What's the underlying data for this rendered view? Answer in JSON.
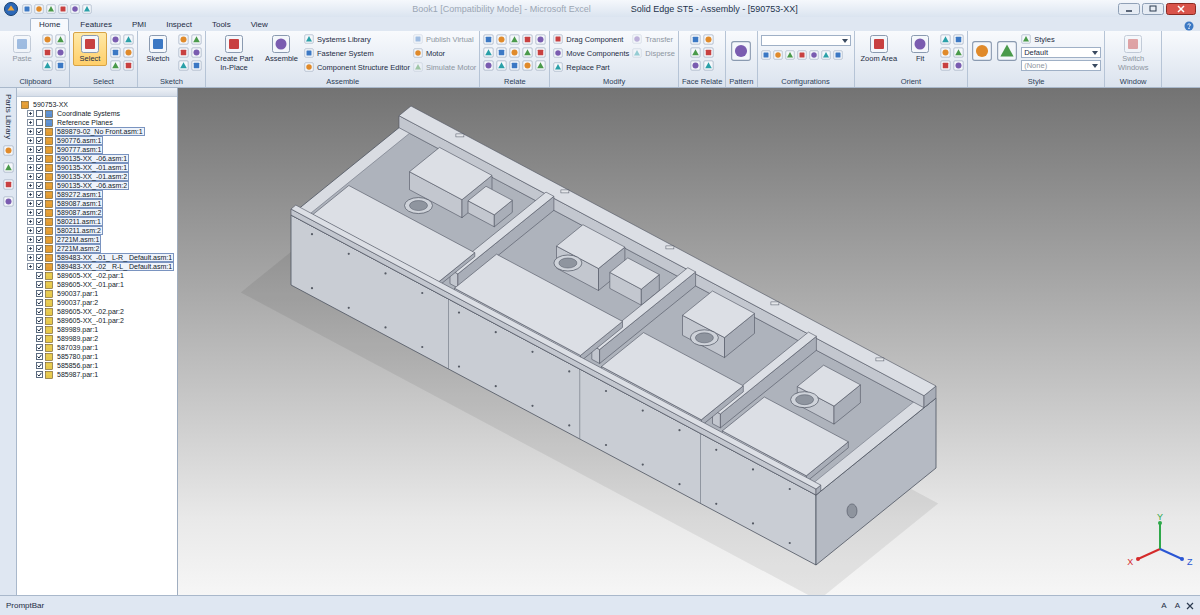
{
  "window": {
    "title": "Solid Edge ST5 - Assembly - [590753-XX]",
    "background_title": "Book1 [Compatibility Mode] - Microsoft Excel"
  },
  "tabs": [
    {
      "label": "Home",
      "selected": true
    },
    {
      "label": "Features",
      "selected": false
    },
    {
      "label": "PMI",
      "selected": false
    },
    {
      "label": "Inspect",
      "selected": false
    },
    {
      "label": "Tools",
      "selected": false
    },
    {
      "label": "View",
      "selected": false
    }
  ],
  "ribbon": [
    {
      "label": "Clipboard",
      "items": [
        {
          "kind": "large",
          "label": "Paste",
          "disabled": true,
          "selected": false
        },
        {
          "kind": "icons",
          "disabled": false
        }
      ]
    },
    {
      "label": "Select",
      "items": [
        {
          "kind": "large",
          "label": "Select",
          "disabled": false,
          "selected": true
        },
        {
          "kind": "icons",
          "disabled": false
        }
      ]
    },
    {
      "label": "Sketch",
      "items": [
        {
          "kind": "large",
          "label": "Sketch",
          "disabled": false,
          "selected": false
        },
        {
          "kind": "icons",
          "disabled": false
        }
      ]
    },
    {
      "label": "Assemble",
      "items": [
        {
          "kind": "large",
          "label": "Create Part In-Place",
          "disabled": false,
          "selected": false
        },
        {
          "kind": "large",
          "label": "Assemble",
          "disabled": false,
          "selected": false
        },
        {
          "kind": "stack",
          "entries": [
            {
              "kind": "item",
              "label": "Systems Library",
              "disabled": false
            },
            {
              "kind": "item",
              "label": "Fastener System",
              "disabled": false
            },
            {
              "kind": "item",
              "label": "Component Structure Editor",
              "disabled": false
            }
          ]
        },
        {
          "kind": "stack",
          "entries": [
            {
              "kind": "item",
              "label": "Publish Virtual",
              "disabled": true
            },
            {
              "kind": "item",
              "label": "Motor",
              "disabled": false
            },
            {
              "kind": "item",
              "label": "Simulate Motor",
              "disabled": true
            }
          ]
        }
      ]
    },
    {
      "label": "Relate",
      "items": [
        {
          "kind": "icon-bank",
          "disabled": false
        }
      ]
    },
    {
      "label": "Modify",
      "items": [
        {
          "kind": "stack",
          "entries": [
            {
              "kind": "item",
              "label": "Drag Component",
              "disabled": false
            },
            {
              "kind": "item",
              "label": "Move Components",
              "disabled": false
            },
            {
              "kind": "item",
              "label": "Replace Part",
              "disabled": false
            }
          ]
        },
        {
          "kind": "stack",
          "entries": [
            {
              "kind": "item",
              "label": "Transfer",
              "disabled": true
            },
            {
              "kind": "item",
              "label": "Disperse",
              "disabled": true
            }
          ]
        }
      ]
    },
    {
      "label": "Face Relate",
      "items": [
        {
          "kind": "icons",
          "disabled": false
        }
      ]
    },
    {
      "label": "Pattern",
      "items": [
        {
          "kind": "big-icon",
          "disabled": false
        }
      ]
    },
    {
      "label": "Configurations",
      "items": [
        {
          "kind": "combo-bar",
          "disabled": false
        }
      ]
    },
    {
      "label": "Orient",
      "items": [
        {
          "kind": "large",
          "label": "Zoom Area",
          "disabled": false,
          "selected": false
        },
        {
          "kind": "large",
          "label": "Fit",
          "disabled": false,
          "selected": false
        },
        {
          "kind": "icons",
          "disabled": false
        }
      ]
    },
    {
      "label": "Style",
      "items": [
        {
          "kind": "big-icon",
          "disabled": false
        },
        {
          "kind": "big-icon",
          "disabled": false
        },
        {
          "kind": "stack",
          "entries": [
            {
              "kind": "item",
              "label": "Styles",
              "disabled": false
            },
            {
              "kind": "dropdown",
              "label": "Default",
              "disabled": false
            },
            {
              "kind": "dropdown",
              "label": "(None)",
              "disabled": true
            }
          ]
        }
      ]
    },
    {
      "label": "Window",
      "items": [
        {
          "kind": "large",
          "label": "Switch Windows",
          "disabled": true,
          "selected": false
        }
      ]
    }
  ],
  "side_strip": {
    "label": "Parts Library"
  },
  "tree": {
    "root": "590753-XX",
    "items": [
      {
        "label": "Coordinate Systems",
        "kind": "folder",
        "checked": false,
        "selected": false,
        "expanded": false
      },
      {
        "label": "Reference Planes",
        "kind": "folder",
        "checked": false,
        "selected": false,
        "expanded": false
      },
      {
        "label": "589879-02_No Front.asm:1",
        "kind": "asm",
        "checked": true,
        "selected": true,
        "expanded": false
      },
      {
        "label": "590776.asm:1",
        "kind": "asm",
        "checked": true,
        "selected": true,
        "expanded": false
      },
      {
        "label": "590777.asm:1",
        "kind": "asm",
        "checked": true,
        "selected": true,
        "expanded": false
      },
      {
        "label": "590135-XX_-06.asm:1",
        "kind": "asm",
        "checked": true,
        "selected": true,
        "expanded": false
      },
      {
        "label": "590135-XX_-01.asm:1",
        "kind": "asm",
        "checked": true,
        "selected": true,
        "expanded": false
      },
      {
        "label": "590135-XX_-01.asm:2",
        "kind": "asm",
        "checked": true,
        "selected": true,
        "expanded": false
      },
      {
        "label": "590135-XX_-06.asm:2",
        "kind": "asm",
        "checked": true,
        "selected": true,
        "expanded": false
      },
      {
        "label": "589272.asm:1",
        "kind": "asm",
        "checked": true,
        "selected": true,
        "expanded": false
      },
      {
        "label": "589087.asm:1",
        "kind": "asm",
        "checked": true,
        "selected": true,
        "expanded": false
      },
      {
        "label": "589087.asm:2",
        "kind": "asm",
        "checked": true,
        "selected": true,
        "expanded": false
      },
      {
        "label": "580211.asm:1",
        "kind": "asm",
        "checked": true,
        "selected": true,
        "expanded": false
      },
      {
        "label": "580211.asm:2",
        "kind": "asm",
        "checked": true,
        "selected": true,
        "expanded": false
      },
      {
        "label": "2721M.asm:1",
        "kind": "asm",
        "checked": true,
        "selected": true,
        "expanded": false
      },
      {
        "label": "2721M.asm:2",
        "kind": "asm",
        "checked": true,
        "selected": true,
        "expanded": false
      },
      {
        "label": "589483-XX_-01_ L-R_ Default.asm:1",
        "kind": "asm",
        "checked": true,
        "selected": true,
        "expanded": false
      },
      {
        "label": "589483-XX_-02_ R-L_ Default.asm:1",
        "kind": "asm",
        "checked": true,
        "selected": true,
        "expanded": false
      },
      {
        "label": "589605-XX_-02.par:1",
        "kind": "par",
        "checked": true,
        "selected": false
      },
      {
        "label": "589605-XX_-01.par:1",
        "kind": "par",
        "checked": true,
        "selected": false
      },
      {
        "label": "590037.par:1",
        "kind": "par",
        "checked": true,
        "selected": false
      },
      {
        "label": "590037.par:2",
        "kind": "par",
        "checked": true,
        "selected": false
      },
      {
        "label": "589605-XX_-02.par:2",
        "kind": "par",
        "checked": true,
        "selected": false
      },
      {
        "label": "589605-XX_-01.par:2",
        "kind": "par",
        "checked": true,
        "selected": false
      },
      {
        "label": "589989.par:1",
        "kind": "par",
        "checked": true,
        "selected": false
      },
      {
        "label": "589989.par:2",
        "kind": "par",
        "checked": true,
        "selected": false
      },
      {
        "label": "587039.par:1",
        "kind": "par",
        "checked": true,
        "selected": false
      },
      {
        "label": "585780.par:1",
        "kind": "par",
        "checked": true,
        "selected": false
      },
      {
        "label": "585856.par:1",
        "kind": "par",
        "checked": true,
        "selected": false
      },
      {
        "label": "585987.par:1",
        "kind": "par",
        "checked": true,
        "selected": false
      }
    ]
  },
  "triad": [
    {
      "axis": "X",
      "color": "#d42a2a"
    },
    {
      "axis": "Y",
      "color": "#2fa84a"
    },
    {
      "axis": "Z",
      "color": "#2a56d4"
    }
  ],
  "prompt_bar": {
    "label": "PromptBar",
    "tools": [
      "A",
      "A"
    ]
  }
}
